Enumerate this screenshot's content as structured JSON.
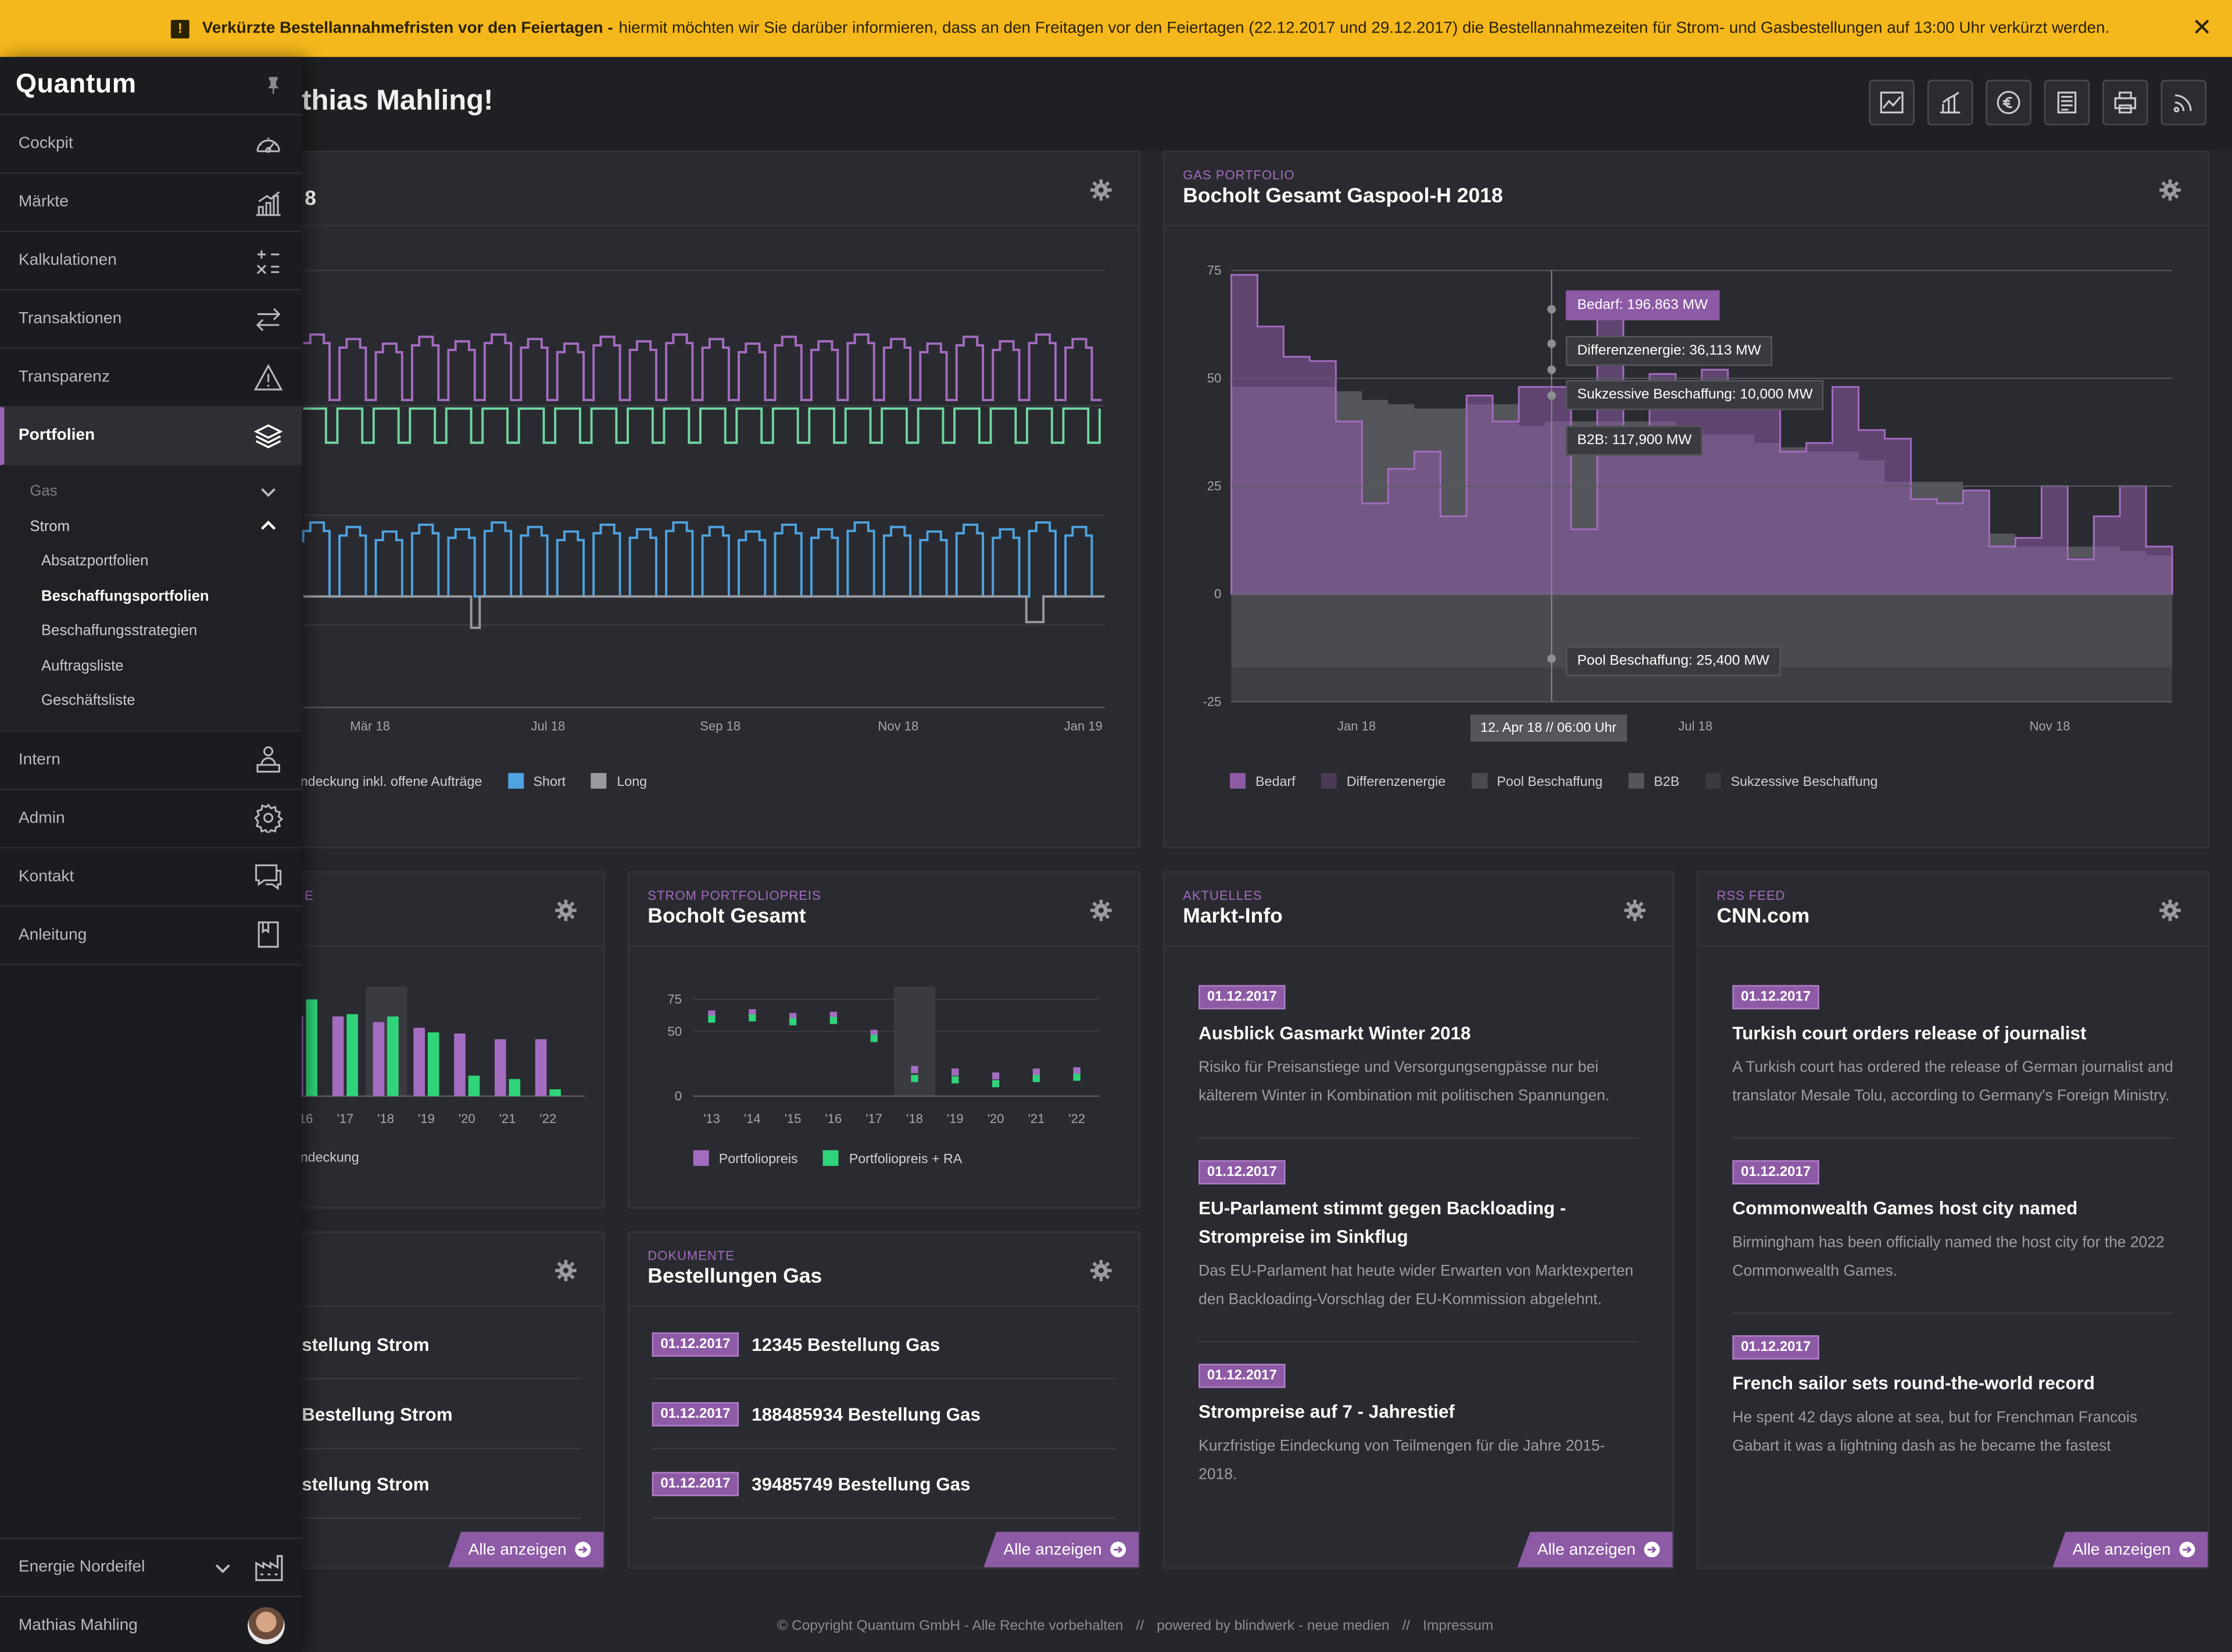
{
  "banner": {
    "title": "Verkürzte Bestellannahmefristen vor den Feiertagen -",
    "text": "hiermit möchten wir Sie darüber informieren, dass an den Freitagen vor den Feiertagen (22.12.2017 und 29.12.2017) die Bestellannahmezeiten für Strom- und Gasbestellungen auf 13:00 Uhr verkürzt werden.",
    "warn_icon": "!",
    "close_icon": "✕"
  },
  "header": {
    "greeting": "thias Mahling!",
    "toolbar_icons": [
      "chart-area-icon",
      "chart-bars-icon",
      "euro-icon",
      "document-list-icon",
      "printer-icon",
      "rss-icon"
    ]
  },
  "sidebar": {
    "logo": "Quantum",
    "items": [
      {
        "label": "Cockpit",
        "icon": "speedometer-icon"
      },
      {
        "label": "Märkte",
        "icon": "bar-chart-icon"
      },
      {
        "label": "Kalkulationen",
        "icon": "calculator-icon"
      },
      {
        "label": "Transaktionen",
        "icon": "arrows-exchange-icon"
      },
      {
        "label": "Transparenz",
        "icon": "warning-icon"
      },
      {
        "label": "Portfolien",
        "icon": "layers-icon",
        "active": true
      },
      {
        "label": "Intern",
        "icon": "person-desk-icon"
      },
      {
        "label": "Admin",
        "icon": "gear-icon"
      },
      {
        "label": "Kontakt",
        "icon": "chat-icon"
      },
      {
        "label": "Anleitung",
        "icon": "book-icon"
      }
    ],
    "sub": {
      "gas": "Gas",
      "strom": "Strom",
      "strom_items": [
        "Absatzportfolien",
        "Beschaffungsportfolien",
        "Beschaffungsstrategien",
        "Auftragsliste",
        "Geschäftsliste"
      ],
      "active_item": "Beschaffungsportfolien"
    },
    "company": "Energie Nordeifel",
    "user": "Mathias Mahling"
  },
  "panels": {
    "strom_chart": {
      "title_fragment": "8",
      "legend": [
        "ndeckung inkl. offene Aufträge",
        "Short",
        "Long"
      ]
    },
    "gas_portfolio": {
      "kicker": "GAS PORTFOLIO",
      "title": "Bocholt Gesamt Gaspool-H 2018",
      "tooltips": {
        "bedarf": "Bedarf: 196.863 MW",
        "diff": "Differenzenergie: 36,113 MW",
        "sukz": "Sukzessive Beschaffung: 10,000 MW",
        "b2b": "B2B: 117,900 MW",
        "pool": "Pool Beschaffung: 25,400 MW",
        "x": "12. Apr 18 // 06:00 Uhr"
      },
      "legend": [
        "Bedarf",
        "Differenzenergie",
        "Pool Beschaffung",
        "B2B",
        "Sukzessive Beschaffung"
      ]
    },
    "bars_left": {
      "kicker_fragment": "E",
      "legend": "ndeckung"
    },
    "portfoliopreis": {
      "kicker": "STROM PORTFOLIOPREIS",
      "title": "Bocholt Gesamt",
      "legend": [
        "Portfoliopreis",
        "Portfoliopreis + RA"
      ]
    },
    "markt": {
      "kicker": "AKTUELLES",
      "title": "Markt-Info",
      "items": [
        {
          "date": "01.12.2017",
          "title": "Ausblick Gasmarkt Winter 2018",
          "text": "Risiko für Preisanstiege und Versorgungsengpässe nur bei kälterem Winter in Kombination mit politischen Spannungen."
        },
        {
          "date": "01.12.2017",
          "title": "EU-Parlament stimmt gegen Backloading - Strompreise im Sinkflug",
          "text": "Das EU-Parlament hat heute wider Erwarten von Marktexperten den Backloading-Vorschlag der EU-Kommission abgelehnt."
        },
        {
          "date": "01.12.2017",
          "title": "Strompreise auf 7 - Jahrestief",
          "text": "Kurzfristige Eindeckung von Teilmengen für die Jahre 2015-2018."
        }
      ],
      "more": "Alle anzeigen"
    },
    "rss": {
      "kicker": "RSS FEED",
      "title": "CNN.com",
      "items": [
        {
          "date": "01.12.2017",
          "title": "Turkish court orders release of journalist",
          "text": "A Turkish court has ordered the release of German journalist and translator Mesale Tolu, according to Germany's Foreign Ministry."
        },
        {
          "date": "01.12.2017",
          "title": "Commonwealth Games host city named",
          "text": "Birmingham has been officially named the host city for the 2022 Commonwealth Games."
        },
        {
          "date": "01.12.2017",
          "title": "French sailor sets round-the-world record",
          "text": "He spent 42 days alone at sea, but for Frenchman Francois Gabart it was a lightning dash as he became the fastest"
        }
      ],
      "more": "Alle anzeigen"
    },
    "docs_strom": {
      "items": [
        "stellung Strom",
        "Bestellung Strom",
        "stellung Strom"
      ],
      "more": "Alle anzeigen"
    },
    "docs_gas": {
      "kicker": "DOKUMENTE",
      "title": "Bestellungen Gas",
      "items": [
        {
          "date": "01.12.2017",
          "title": "12345 Bestellung Gas"
        },
        {
          "date": "01.12.2017",
          "title": "188485934 Bestellung Gas"
        },
        {
          "date": "01.12.2017",
          "title": "39485749 Bestellung Gas"
        }
      ],
      "more": "Alle anzeigen"
    }
  },
  "footer": {
    "copyright": "© Copyright Quantum GmbH - Alle Rechte vorbehalten",
    "sep": "//",
    "powered": "powered by blindwerk - neue medien",
    "impressum": "Impressum"
  },
  "colors": {
    "accent": "#8d5aa6",
    "banner": "#f5b81c",
    "short": "#4fa3e0",
    "long": "#9a9b9f",
    "green": "#2fd47a",
    "bg": "#26272b"
  },
  "chart_data": [
    {
      "type": "line",
      "title": "",
      "x_ticks": [
        "Mär 18",
        "Jul 18",
        "Sep 18",
        "Nov 18",
        "Jan 19"
      ],
      "series": [
        {
          "name": "ndeckung inkl. offene Aufträge",
          "color": "#a46cc0",
          "pattern": "weekly step profile, upper band"
        },
        {
          "name": "",
          "color": "#6fd6a0",
          "pattern": "flat with weekly dips"
        },
        {
          "name": "Short",
          "color": "#4fa3e0",
          "pattern": "weekly step profile, lower band"
        },
        {
          "name": "Long",
          "color": "#9a9b9f",
          "pattern": "baseline with small dips"
        }
      ]
    },
    {
      "type": "area",
      "title": "Bocholt Gesamt Gaspool-H 2018",
      "y_ticks": [
        75,
        50,
        25,
        0,
        -25
      ],
      "ylim": [
        -25,
        75
      ],
      "x_ticks": [
        "Jan 18",
        "Jul 18",
        "Nov 18"
      ],
      "series": [
        {
          "name": "Bedarf",
          "color": "#8d5aa6",
          "sample_values": [
            74,
            62,
            55,
            54,
            40,
            21,
            29,
            33,
            18,
            46,
            40,
            48,
            48,
            15,
            66,
            37,
            51,
            43,
            52,
            43,
            46,
            33,
            35,
            48,
            38,
            36,
            22,
            21,
            24,
            11,
            13,
            25,
            8,
            18,
            25,
            11
          ]
        },
        {
          "name": "Differenzenergie",
          "color": "#4b3a55"
        },
        {
          "name": "Pool Beschaffung",
          "color": "#4a4b50"
        },
        {
          "name": "B2B",
          "color": "#55565b"
        },
        {
          "name": "Sukzessive Beschaffung",
          "color": "#3a3b40"
        }
      ],
      "grid": true,
      "legend_position": "bottom"
    },
    {
      "type": "bar",
      "title": "",
      "categories": [
        "'16",
        "'17",
        "'18",
        "'19",
        "'20",
        "'21",
        "'22"
      ],
      "series": [
        {
          "name": "",
          "color": "#a46cc0",
          "values": [
            70,
            70,
            65,
            60,
            55,
            50,
            50
          ]
        },
        {
          "name": "ndeckung",
          "color": "#2fd47a",
          "values": [
            85,
            72,
            70,
            56,
            18,
            15,
            6
          ]
        }
      ]
    },
    {
      "type": "scatter",
      "title": "Bocholt Gesamt",
      "categories": [
        "'13",
        "'14",
        "'15",
        "'16",
        "'17",
        "'18",
        "'19",
        "'20",
        "'21",
        "'22"
      ],
      "ylim": [
        0,
        75
      ],
      "y_ticks": [
        75,
        50,
        0
      ],
      "series": [
        {
          "name": "Portfoliopreis",
          "color": "#a46cc0",
          "values": [
            62,
            63,
            60,
            61,
            47,
            19,
            17,
            14,
            17,
            18
          ]
        },
        {
          "name": "Portfoliopreis + RA",
          "color": "#2fd47a",
          "values": [
            58,
            59,
            56,
            57,
            43,
            12,
            11,
            8,
            12,
            13
          ]
        }
      ],
      "legend_position": "bottom"
    }
  ]
}
